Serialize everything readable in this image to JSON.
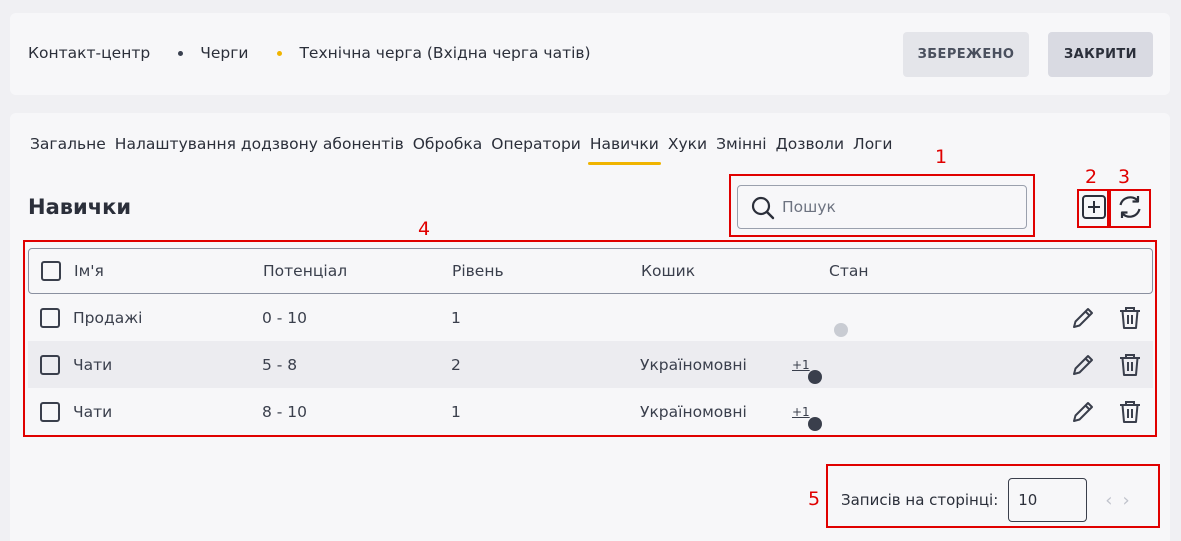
{
  "breadcrumb": {
    "items": [
      "Контакт-центр",
      "Черги",
      "Технічна черга (Вхідна черга чатів)"
    ]
  },
  "header_buttons": {
    "saved": "ЗБЕРЕЖЕНО",
    "close": "ЗАКРИТИ"
  },
  "tabs": [
    {
      "label": "Загальне"
    },
    {
      "label": "Налаштування додзвону абонентів"
    },
    {
      "label": "Обробка"
    },
    {
      "label": "Оператори"
    },
    {
      "label": "Навички",
      "active": true
    },
    {
      "label": "Хуки"
    },
    {
      "label": "Змінні"
    },
    {
      "label": "Дозволи"
    },
    {
      "label": "Логи"
    }
  ],
  "section": {
    "title": "Навички"
  },
  "search": {
    "placeholder": "Пошук",
    "value": ""
  },
  "table": {
    "columns": [
      "Ім'я",
      "Потенціал",
      "Рівень",
      "Кошик",
      "Стан"
    ],
    "rows": [
      {
        "name": "Продажі",
        "potential": "0 - 10",
        "level": "1",
        "basket": "",
        "more": "",
        "enabled": false
      },
      {
        "name": "Чати",
        "potential": "5 - 8",
        "level": "2",
        "basket": "Україномовні",
        "more": "+1",
        "enabled": true
      },
      {
        "name": "Чати",
        "potential": "8 - 10",
        "level": "1",
        "basket": "Україномовні",
        "more": "+1",
        "enabled": true
      }
    ]
  },
  "pagination": {
    "label": "Записів на сторінці:",
    "per_page": "10"
  },
  "annotations": [
    "1",
    "2",
    "3",
    "4",
    "5"
  ],
  "colors": {
    "accent": "#f0b400",
    "annotation": "#e00000",
    "toggle_off": "#3d4356"
  }
}
